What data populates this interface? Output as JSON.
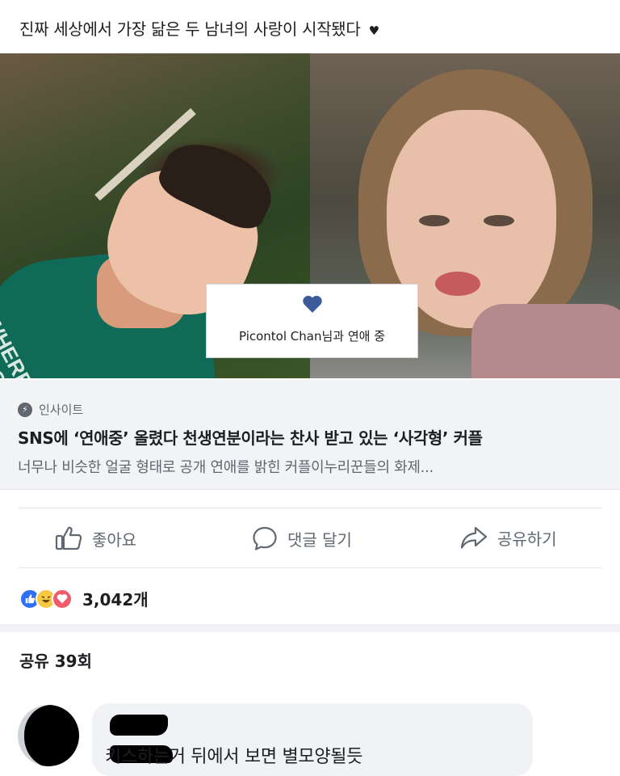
{
  "post": {
    "status_text": "진짜 세상에서 가장 닮은 두 남녀의 사랑이 시작됐다",
    "status_emoji": "♥"
  },
  "link_preview": {
    "relationship_text": "Picontol Chan님과 연애 중",
    "source": "인사이트",
    "headline": "SNS에 ‘연애중’ 올렸다 천생연분이라는 찬사 받고 있는 ‘사각형’ 커플",
    "description": "너무나 비슷한 얼굴 형태로 공개 연애를 밝힌 커플이누리꾼들의 화제..."
  },
  "photo_left": {
    "shirt_text": "WHERE YOU\nRE YOUR"
  },
  "actions": {
    "like_label": "좋아요",
    "comment_label": "댓글 달기",
    "share_label": "공유하기"
  },
  "reactions": {
    "count": "3,042개",
    "types": [
      "like",
      "haha",
      "love"
    ]
  },
  "shares": {
    "label": "공유 39회"
  },
  "comment": {
    "text": "키스하는거 뒤에서 보면 별모양될듯"
  },
  "colors": {
    "link_bg": "#f2f3f5",
    "heart": "#3b5b9a",
    "secondary_text": "#606770",
    "like": "#2d6ff7",
    "love": "#f25b6a",
    "haha": "#f7c843"
  }
}
